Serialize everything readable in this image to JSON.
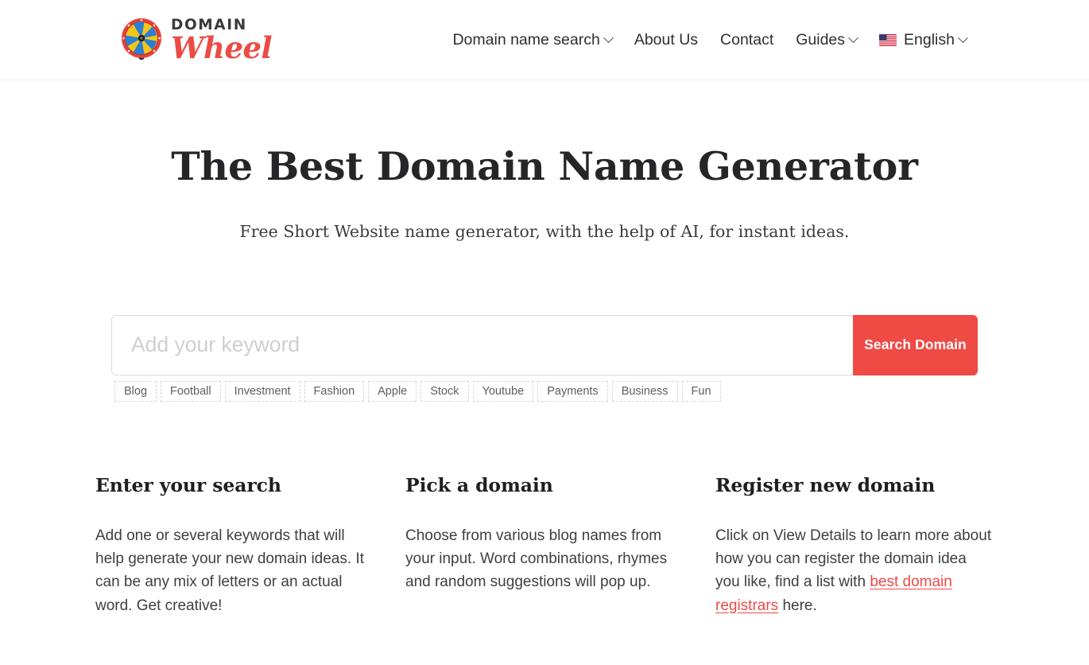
{
  "header": {
    "brand": {
      "logo_icon": "prize-wheel-icon",
      "top_text": "DOMAIN",
      "bottom_text": "Wheel",
      "colors": {
        "wheel_rim": "#e8413c",
        "wheel_segment_a": "#f5c518",
        "wheel_segment_b": "#2b7fd4",
        "wheel_hub": "#231f20",
        "wordmark_top": "#3a3a3c",
        "wordmark_bottom": "#ec4b45"
      }
    },
    "nav": [
      {
        "label": "Domain name search",
        "has_dropdown": true,
        "icon": "chevron-down-icon"
      },
      {
        "label": "About Us",
        "has_dropdown": false,
        "icon": ""
      },
      {
        "label": "Contact",
        "has_dropdown": false,
        "icon": ""
      },
      {
        "label": "Guides",
        "has_dropdown": true,
        "icon": "chevron-down-icon"
      },
      {
        "label": "English",
        "has_dropdown": true,
        "icon": "chevron-down-icon",
        "flag": "us-flag-icon"
      }
    ]
  },
  "hero": {
    "title": "The Best Domain Name Generator",
    "subtitle": "Free Short Website name generator, with the help of AI, for instant ideas."
  },
  "search": {
    "placeholder": "Add your keyword",
    "value": "",
    "button_label": "Search Domain",
    "button_color": "#ef4a44",
    "suggestions": [
      "Blog",
      "Football",
      "Investment",
      "Fashion",
      "Apple",
      "Stock",
      "Youtube",
      "Payments",
      "Business",
      "Fun"
    ]
  },
  "features": [
    {
      "title": "Enter your search",
      "body": "Add one or several keywords that will help generate your new domain ideas. It can be any mix of letters or an actual word. Get creative!",
      "link_text": "",
      "body_before_link": "",
      "body_after_link": ""
    },
    {
      "title": "Pick a domain",
      "body": "Choose from various blog names from your input. Word combinations, rhymes and random suggestions will pop up.",
      "link_text": "",
      "body_before_link": "",
      "body_after_link": ""
    },
    {
      "title": "Register new domain",
      "body": "",
      "body_before_link": "Click on View Details to learn more about how you can register the domain idea you like, find a list with ",
      "link_text": "best domain registrars",
      "body_after_link": " here.",
      "link_color": "#ef4a44"
    }
  ]
}
